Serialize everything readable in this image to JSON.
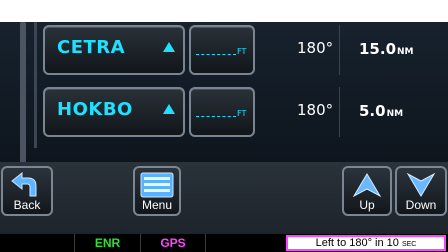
{
  "flight_plan": {
    "rows": [
      {
        "waypoint": "CETRA",
        "altitude_unit": "FT",
        "dtk": "180°",
        "distance": "15.0",
        "distance_unit": "NM"
      },
      {
        "waypoint": "HOKBO",
        "altitude_unit": "FT",
        "dtk": "180°",
        "distance": "5.0",
        "distance_unit": "NM"
      }
    ]
  },
  "softkeys": {
    "back": {
      "label": "Back",
      "icon": "back-arrow-icon"
    },
    "menu": {
      "label": "Menu",
      "icon": "menu-list-icon"
    },
    "up": {
      "label": "Up",
      "icon": "up-arrow-icon"
    },
    "down": {
      "label": "Down",
      "icon": "down-arrow-icon"
    }
  },
  "status": {
    "mode": "ENR",
    "nav_source": "GPS",
    "message": "Left to 180° in 10",
    "message_unit": "SEC",
    "colors": {
      "mode": "#2fe02f",
      "nav_source": "#ff44ff",
      "message_border": "#ff44ff",
      "waypoint": "#20e0ff"
    }
  }
}
